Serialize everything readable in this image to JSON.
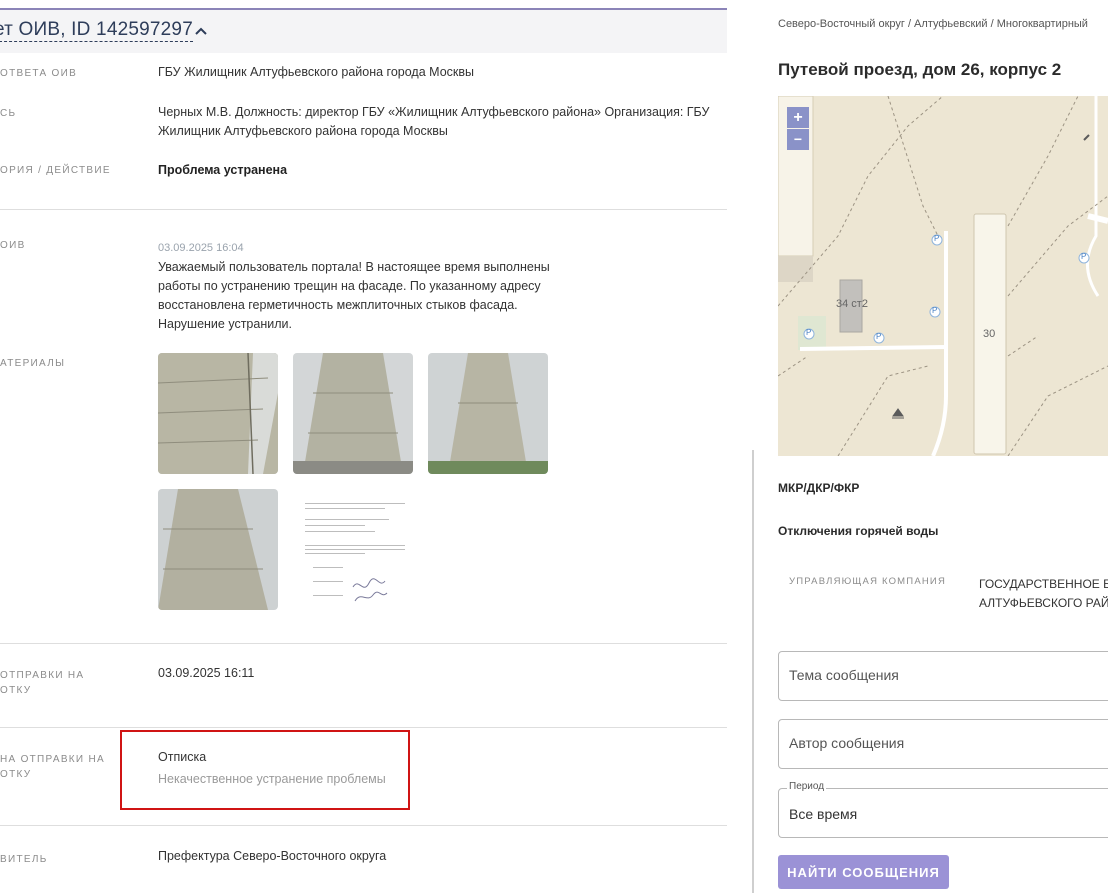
{
  "answer": {
    "title": "ет ОИВ, ID 142597297",
    "labels": {
      "oiv": "ответа оив",
      "signature": "сь",
      "category": "ория / действие",
      "oiv_answer": "оив",
      "materials": "атериалы",
      "sent_date": "отправки на",
      "sent_date_2": "отку",
      "reason": "на отправки на",
      "reason_2": "отку",
      "executor": "витель"
    },
    "values": {
      "oiv": "ГБУ Жилищник Алтуфьевского района города Москвы",
      "signature_line1": "Черных М.В. Должность: директор ГБУ «Жилищник Алтуфьевского района» Организация: ГБУ",
      "signature_line2": "Жилищник Алтуфьевского района города Москвы",
      "category": "Проблема устранена",
      "answer_date": "03.09.2025 16:04",
      "answer_text_1": "Уважаемый пользователь портала! В настоящее время выполнены",
      "answer_text_2": "работы по устранению трещин на фасаде. По указанному адресу",
      "answer_text_3": "восстановлена герметичность межплиточных стыков фасада.",
      "answer_text_4": "Нарушение устранили.",
      "sent_date": "03.09.2025 16:11",
      "reason_main": "Отписка",
      "reason_sub": "Некачественное устранение проблемы",
      "executor": "Префектура Северо-Восточного округа"
    }
  },
  "object": {
    "breadcrumb": "Северо-Восточный округ / Алтуфьевский / Многоквартирный",
    "address": "Путевой проезд, дом 26, корпус 2",
    "map": {
      "zoom_in": "+",
      "zoom_out": "−",
      "labels": [
        "34 ст2",
        "30"
      ],
      "parking": "P"
    },
    "section_1": "МКР/ДКР/ФКР",
    "section_2": "Отключения горячей воды",
    "uk_label": "управляющая компания",
    "uk_value_1": "ГОСУДАРСТВЕННОЕ Б",
    "uk_value_2": "АЛТУФЬЕВСКОГО РАЙ"
  },
  "search": {
    "subject_placeholder": "Тема сообщения",
    "author_placeholder": "Автор сообщения",
    "period_label": "Период",
    "period_value": "Все время",
    "submit_label": "НАЙТИ СООБЩЕНИЯ"
  },
  "colors": {
    "accent": "#9b92d6",
    "highlight": "#d01414",
    "map_bg": "#ede6d3"
  }
}
